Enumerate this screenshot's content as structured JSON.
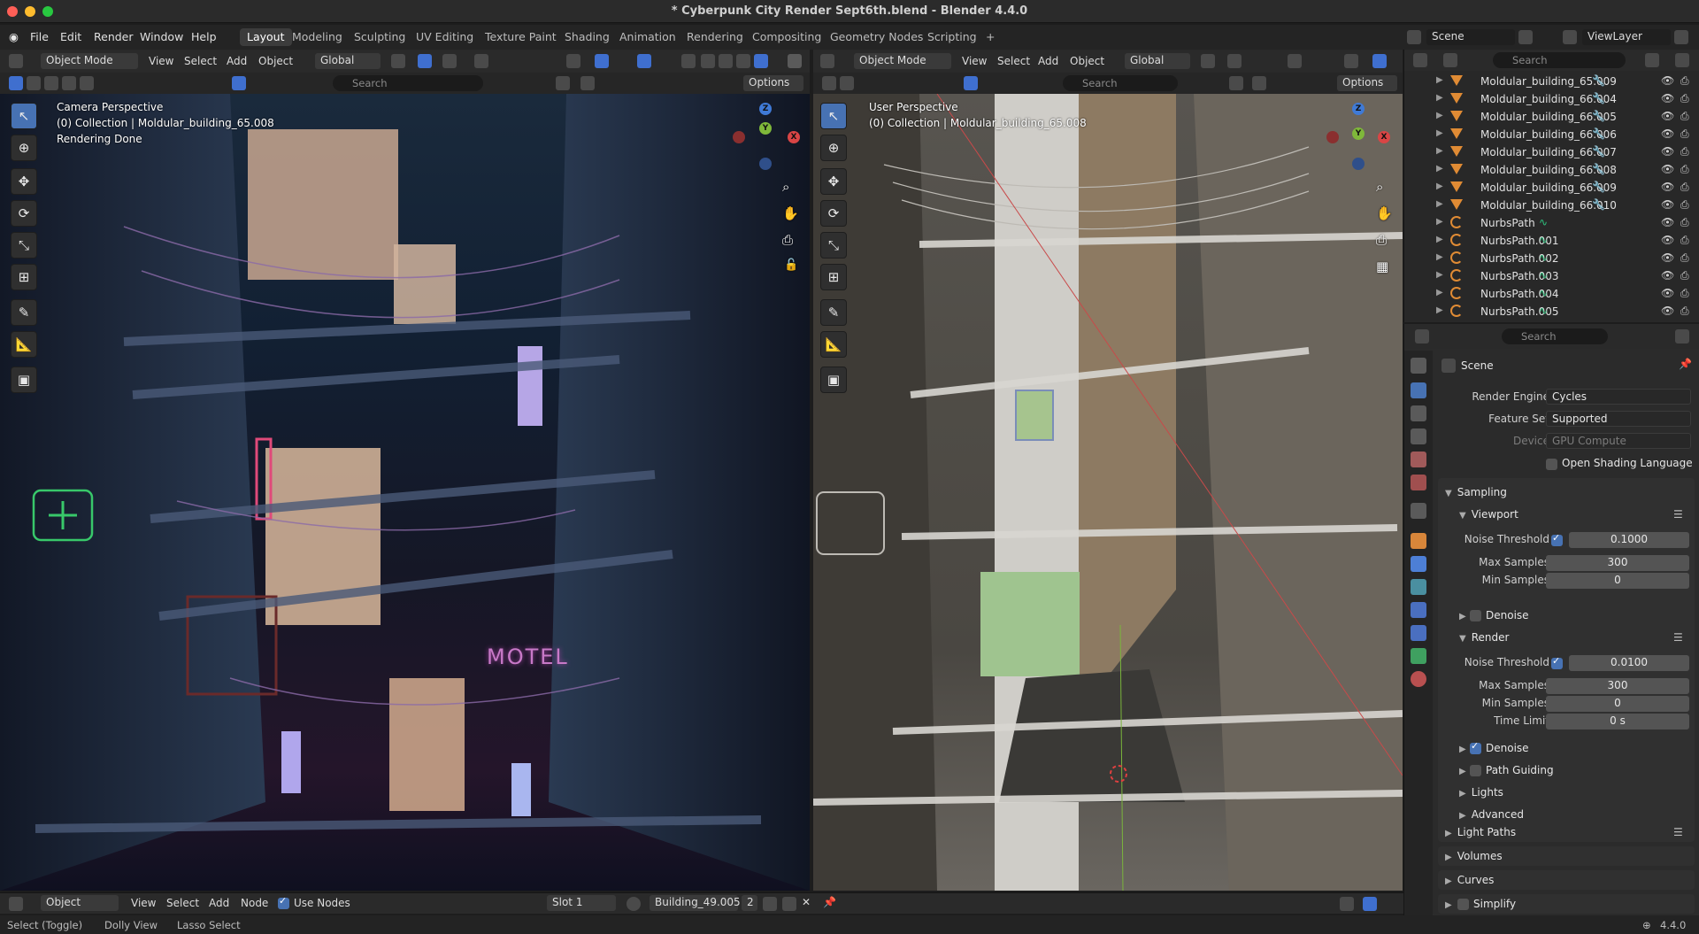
{
  "window": {
    "title": "* Cyberpunk City Render Sept6th.blend - Blender 4.4.0"
  },
  "menu": {
    "items": [
      "File",
      "Edit",
      "Render",
      "Window",
      "Help"
    ]
  },
  "workspaces": [
    {
      "label": "Layout",
      "active": true
    },
    {
      "label": "Modeling"
    },
    {
      "label": "Sculpting"
    },
    {
      "label": "UV Editing"
    },
    {
      "label": "Texture Paint"
    },
    {
      "label": "Shading"
    },
    {
      "label": "Animation"
    },
    {
      "label": "Rendering"
    },
    {
      "label": "Compositing"
    },
    {
      "label": "Geometry Nodes"
    },
    {
      "label": "Scripting"
    }
  ],
  "workspace_add": "+",
  "top_right": {
    "scene": "Scene",
    "view_layer": "ViewLayer"
  },
  "left_viewport": {
    "mode": "Object Mode",
    "menus": [
      "View",
      "Select",
      "Add",
      "Object"
    ],
    "orientation": "Global",
    "search_placeholder": "Search",
    "options": "Options",
    "overlay_line1": "Camera Perspective",
    "overlay_line2": "(0) Collection | Moldular_building_65.008",
    "overlay_line3": "Rendering Done",
    "motel_sign": "MOTEL"
  },
  "right_viewport": {
    "mode": "Object Mode",
    "menus": [
      "View",
      "Select",
      "Add",
      "Object"
    ],
    "orientation": "Global",
    "search_placeholder": "Search",
    "options": "Options",
    "overlay_line1": "User Perspective",
    "overlay_line2": "(0) Collection | Moldular_building_65.008"
  },
  "gizmo": {
    "z": "Z",
    "y": "Y",
    "x": "X"
  },
  "outliner": {
    "search_placeholder": "Search",
    "items": [
      {
        "name": "Moldular_building_65.009",
        "type": "mesh"
      },
      {
        "name": "Moldular_building_66.004",
        "type": "mesh"
      },
      {
        "name": "Moldular_building_66.005",
        "type": "mesh"
      },
      {
        "name": "Moldular_building_66.006",
        "type": "mesh"
      },
      {
        "name": "Moldular_building_66.007",
        "type": "mesh"
      },
      {
        "name": "Moldular_building_66.008",
        "type": "mesh"
      },
      {
        "name": "Moldular_building_66.009",
        "type": "mesh"
      },
      {
        "name": "Moldular_building_66.010",
        "type": "mesh"
      },
      {
        "name": "NurbsPath",
        "type": "curve"
      },
      {
        "name": "NurbsPath.001",
        "type": "curve"
      },
      {
        "name": "NurbsPath.002",
        "type": "curve"
      },
      {
        "name": "NurbsPath.003",
        "type": "curve"
      },
      {
        "name": "NurbsPath.004",
        "type": "curve"
      },
      {
        "name": "NurbsPath.005",
        "type": "curve"
      }
    ]
  },
  "properties": {
    "search_placeholder": "Search",
    "context": "Scene",
    "render_engine_label": "Render Engine",
    "render_engine": "Cycles",
    "feature_set_label": "Feature Set",
    "feature_set": "Supported",
    "device_label": "Device",
    "device": "GPU Compute",
    "osl_label": "Open Shading Language",
    "sampling": "Sampling",
    "viewport": "Viewport",
    "noise_threshold_label": "Noise Threshold",
    "viewport_noise_threshold": "0.1000",
    "max_samples_label": "Max Samples",
    "viewport_max_samples": "300",
    "min_samples_label": "Min Samples",
    "viewport_min_samples": "0",
    "denoise_label": "Denoise",
    "render": "Render",
    "render_noise_threshold": "0.0100",
    "render_max_samples": "300",
    "render_min_samples": "0",
    "time_limit_label": "Time Limit",
    "time_limit": "0 s",
    "path_guiding": "Path Guiding",
    "lights": "Lights",
    "advanced": "Advanced",
    "light_paths": "Light Paths",
    "volumes": "Volumes",
    "curves": "Curves",
    "simplify": "Simplify"
  },
  "bottom_editor": {
    "type": "Object",
    "menus": [
      "View",
      "Select",
      "Add",
      "Node"
    ],
    "use_nodes": "Use Nodes",
    "slot": "Slot 1",
    "material": "Building_49.005",
    "users": "2"
  },
  "status": {
    "select": "Select (Toggle)",
    "dolly": "Dolly View",
    "lasso": "Lasso Select",
    "version": "4.4.0"
  },
  "colors": {
    "accent": "#4772b3",
    "mesh_icon": "#e08b34",
    "curve_icon": "#2ec27e"
  }
}
